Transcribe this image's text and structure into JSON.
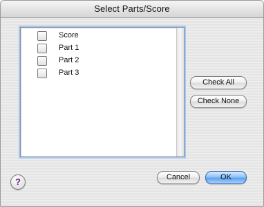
{
  "window": {
    "title": "Select Parts/Score"
  },
  "list": {
    "items": [
      {
        "label": "Score",
        "checked": false
      },
      {
        "label": "Part 1",
        "checked": false
      },
      {
        "label": "Part 2",
        "checked": false
      },
      {
        "label": "Part 3",
        "checked": false
      }
    ]
  },
  "buttons": {
    "check_all": "Check All",
    "check_none": "Check None",
    "cancel": "Cancel",
    "ok": "OK",
    "help": "?"
  },
  "colors": {
    "default_button": "#6aa8f0",
    "focus_ring": "#aac6ea",
    "help_glyph": "#6a1f8a"
  }
}
